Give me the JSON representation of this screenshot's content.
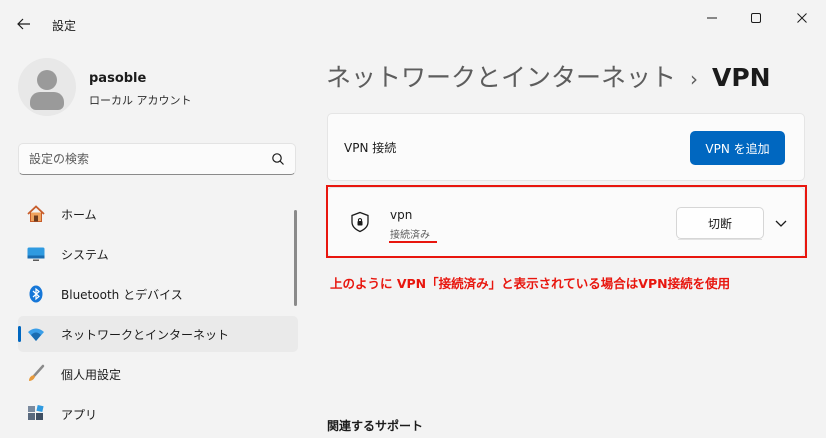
{
  "window": {
    "title": "設定",
    "minimize_icon": "minimize-icon",
    "maximize_icon": "maximize-icon",
    "close_icon": "close-icon"
  },
  "profile": {
    "name": "pasoble",
    "account_type": "ローカル アカウント"
  },
  "search": {
    "placeholder": "設定の検索"
  },
  "sidebar": {
    "items": [
      {
        "label": "ホーム",
        "icon": "home-icon"
      },
      {
        "label": "システム",
        "icon": "system-icon"
      },
      {
        "label": "Bluetooth とデバイス",
        "icon": "bluetooth-icon"
      },
      {
        "label": "ネットワークとインターネット",
        "icon": "wifi-icon",
        "active": true
      },
      {
        "label": "個人用設定",
        "icon": "brush-icon"
      },
      {
        "label": "アプリ",
        "icon": "apps-icon"
      }
    ]
  },
  "breadcrumb": {
    "parent": "ネットワークとインターネット",
    "separator": "›",
    "current": "VPN"
  },
  "vpn_section": {
    "label": "VPN 接続",
    "add_button": "VPN を追加"
  },
  "connection": {
    "name": "vpn",
    "status": "接続済み",
    "disconnect_button": "切断"
  },
  "annotation": {
    "text": "上のように VPN「接続済み」と表示されている場合はVPN接続を使用"
  },
  "support": {
    "heading": "関連するサポート"
  },
  "colors": {
    "accent": "#0067c0",
    "annotation_red": "#e8160e"
  }
}
